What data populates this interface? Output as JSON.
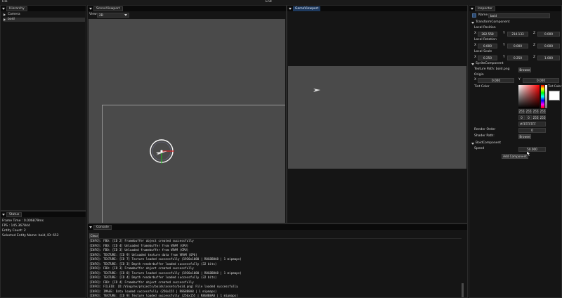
{
  "menu": {
    "file": "File",
    "center": "End"
  },
  "hierarchy": {
    "tab": "Hierarchy",
    "items": [
      {
        "label": "Camera",
        "expanded": false
      },
      {
        "label": "boid",
        "expanded": false,
        "selected": true
      }
    ]
  },
  "status": {
    "tab": "Status",
    "frame_time": "Frame Time  : 0.006879ms",
    "fps": "FPS          : 145.367844",
    "entity_count": "Entity Count: 2",
    "selected": "Selected Entity Name: boid, ID: 652"
  },
  "scene": {
    "tab": "SceneViewport",
    "view_label": "View",
    "view_value": "2D"
  },
  "game": {
    "tab": "GameViewport"
  },
  "console": {
    "tab": "Console",
    "clear": "Clear",
    "lines": [
      "[INFO]: FBO: [ID 2] Framebuffer object created successfully",
      "[INFO]: FBO: [ID 4] Unloaded framebuffer from VRAM (GPU)",
      "[INFO]: FBO: [ID 3] Unloaded framebuffer from VRAM (GPU)",
      "[INFO]: TEXTURE: [ID 9] Unloaded texture data from VRAM (GPU)",
      "[INFO]: TEXTURE: [ID 7] Texture loaded successfully (1920x1080 | R8G8B8A8 | 1 mipmaps)",
      "[INFO]: TEXTURE: [ID 3] Depth renderbuffer loaded successfully (32 bits)",
      "[INFO]: FBO: [ID 3] Framebuffer object created successfully",
      "[INFO]: TEXTURE: [ID 8] Texture loaded successfully (1920x1080 | R8G8B8A8 | 1 mipmaps)",
      "[INFO]: TEXTURE: [ID 4] Depth renderbuffer loaded successfully (32 bits)",
      "[INFO]: FBO: [ID 4] Framebuffer object created successfully",
      "[INFO]: FILEIO: [D:/Ving/ne/projects/boids/assets/boid.png] File loaded successfully",
      "[INFO]: IMAGE: Data loaded successfully (256x155 | R8G8B8A8 | 1 mipmaps)",
      "[INFO]: TEXTURE: [ID 9] Texture loaded successfully (256x155 | R8G8B8A8 | 1 mipmaps)"
    ]
  },
  "inspector": {
    "tab": "Inspector",
    "name_label": "Name",
    "name_value": "boid",
    "transform": {
      "header": "TransformComponent",
      "pos_label": "Local Position",
      "pos": [
        "282.558",
        "214.133",
        "0.000"
      ],
      "rot_label": "Local Rotation",
      "rot": [
        "0.000",
        "0.000",
        "0.000"
      ],
      "scale_label": "Local Scale",
      "scale": [
        "0.250",
        "0.250",
        "1.000"
      ],
      "axes": [
        "X",
        "Y",
        "Z"
      ]
    },
    "sprite": {
      "header": "SpriteComponent",
      "texture_path": "Texture Path: boid.png",
      "browse": "Browse",
      "origin_label": "Origin",
      "origin": [
        "0.000",
        "0.000"
      ],
      "tint_label": "Tint Color",
      "tint_popup_label": "Tint Color",
      "rgba": [
        "255",
        "255",
        "255",
        "255"
      ],
      "hsv": [
        "0",
        "0",
        "255",
        "255"
      ],
      "hex": "#FFFFFFFF",
      "render_order_label": "Render Order",
      "render_order": "0",
      "shader_label": "Shader Path:",
      "shader_browse": "Browse"
    },
    "boid": {
      "header": "BoidComponent",
      "speed_label": "Speed",
      "speed": "50.000"
    },
    "add_component": "Add Component"
  },
  "colors": {
    "accent": "#1e3a5f",
    "viewport_bg": "#4a4a4a",
    "selection": "#2a4a73"
  }
}
